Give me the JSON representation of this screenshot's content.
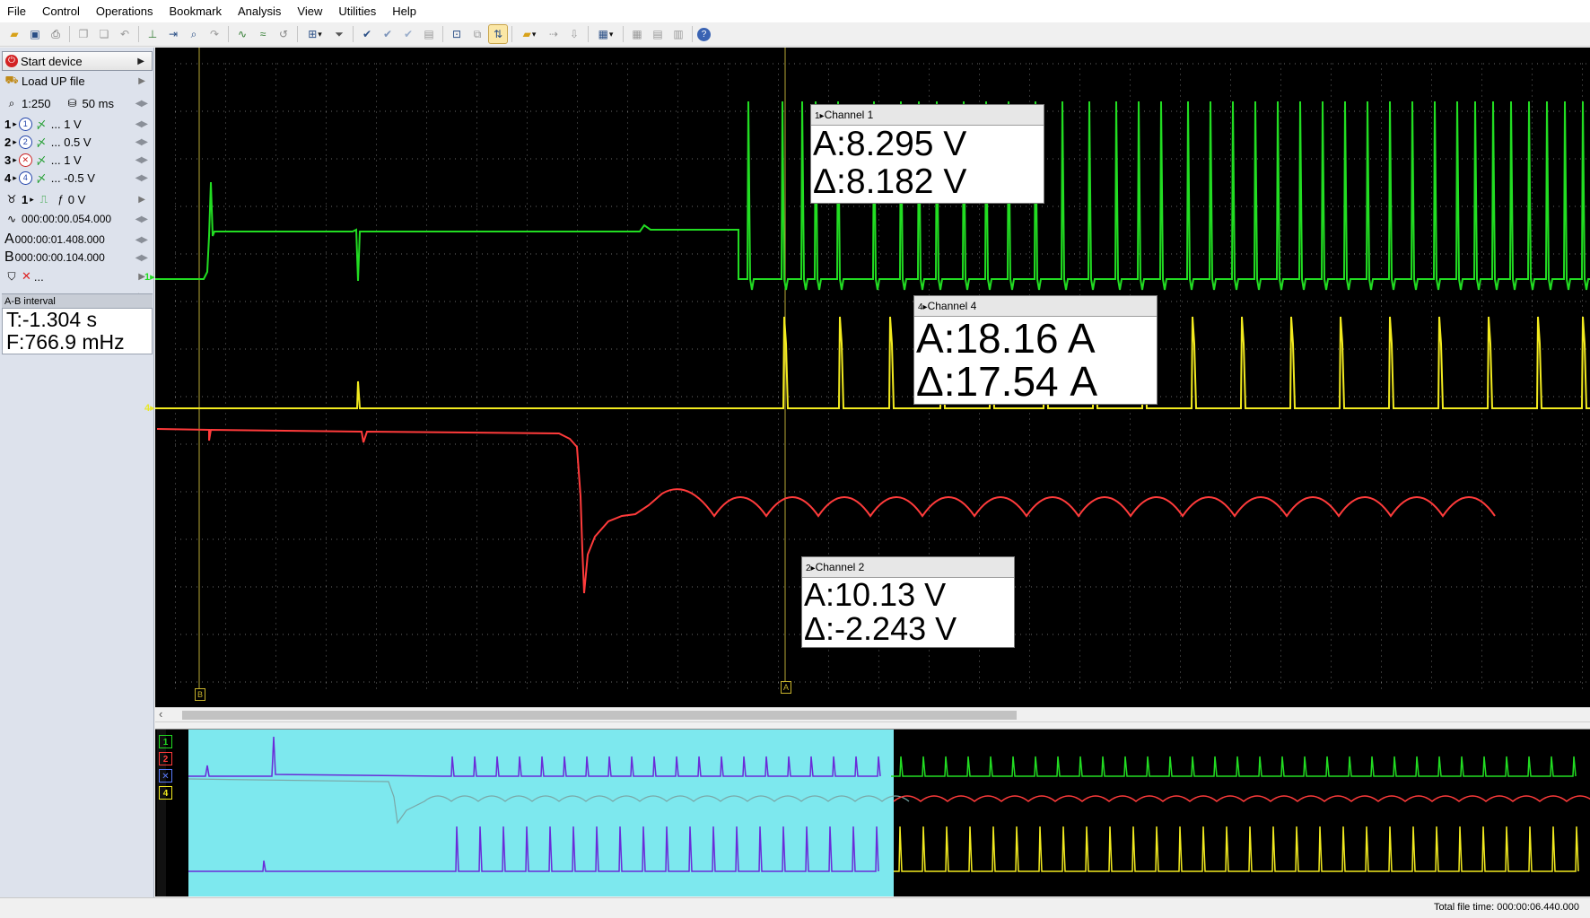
{
  "menu": [
    "File",
    "Control",
    "Operations",
    "Bookmark",
    "Analysis",
    "View",
    "Utilities",
    "Help"
  ],
  "left_panel": {
    "start_device": "Start device",
    "load_file": "Load UP file",
    "zoom": "1:250",
    "timebase": "50 ms",
    "channels": [
      {
        "num": "1",
        "circle": "1",
        "value": "... 1 V"
      },
      {
        "num": "2",
        "circle": "2",
        "value": "... 0.5 V"
      },
      {
        "num": "3",
        "circle": "",
        "value": "... 1 V"
      },
      {
        "num": "4",
        "circle": "4",
        "value": "... -0.5 V"
      }
    ],
    "trigger_channel": "1",
    "trigger_level": "0 V",
    "pretrigger_time": "000:00:00.054.000",
    "cursor_a_time": "000:00:01.408.000",
    "cursor_b_time": "000:00:00.104.000",
    "filter_value": "...",
    "phase_value": "...",
    "ab_interval": {
      "header": "A-B interval",
      "t": "T:-1.304 s",
      "f": "F:766.9 mHz"
    }
  },
  "scope": {
    "channel_markers": [
      {
        "label": "1",
        "color": "#22dd22"
      },
      {
        "label": "4",
        "color": "#e8e82a"
      }
    ],
    "cursor_labels": {
      "a": "A",
      "b": "B"
    },
    "readouts": [
      {
        "title": "Channel 1",
        "a": "A:8.295 V",
        "d": "Δ:8.182 V"
      },
      {
        "title": "Channel 4",
        "a": "A:18.16 A",
        "d": "Δ:17.54 A"
      },
      {
        "title": "Channel 2",
        "a": "A:10.13 V",
        "d": "Δ:-2.243 V"
      }
    ],
    "colors": {
      "ch1": "#22dd22",
      "ch2": "#ff3b3b",
      "ch4": "#f2ea1f",
      "grid": "#6a6a6a",
      "cursor": "#b8a836",
      "overview_window": "#7de8ee",
      "overview_highlight": "#6a2bd8"
    }
  },
  "overview_labels": [
    "1",
    "2",
    "",
    "4"
  ],
  "status": {
    "total_time": "Total file time: 000:00:06.440.000"
  }
}
